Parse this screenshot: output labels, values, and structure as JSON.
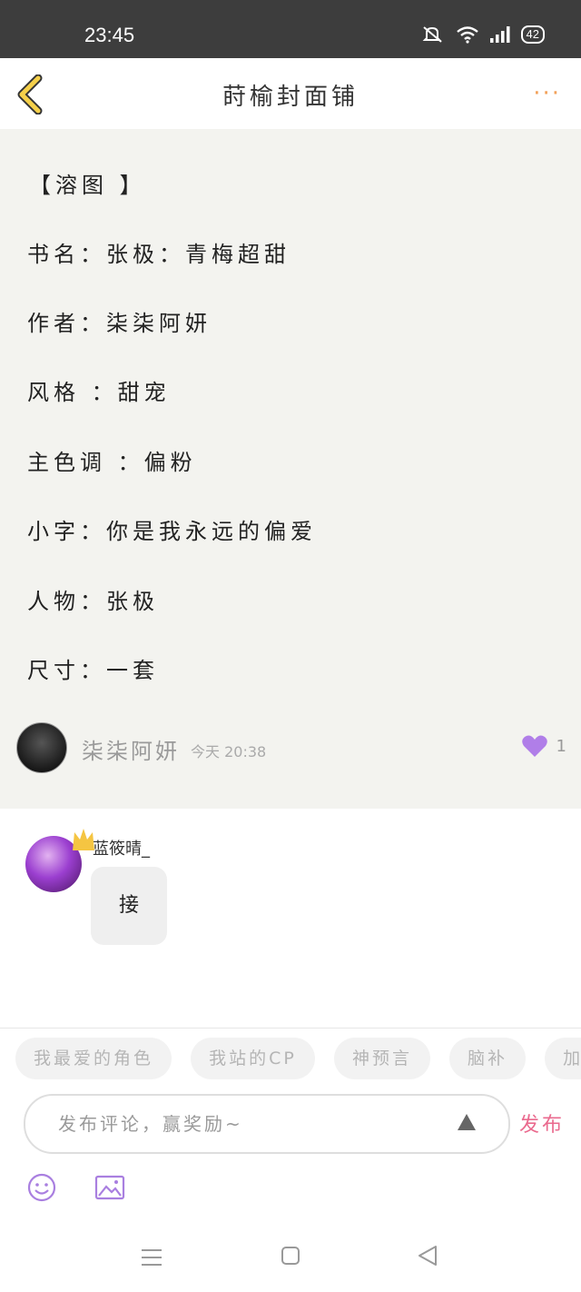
{
  "status_bar": {
    "time": "23:45",
    "battery": "42"
  },
  "header": {
    "title": "莳榆封面铺",
    "more_label": "···"
  },
  "post": {
    "lines": [
      "【溶图 】",
      "书名：张极：青梅超甜",
      "作者：柒柒阿妍",
      "风格 ：甜宠",
      "主色调 ：偏粉",
      "小字：你是我永远的偏爱",
      "人物：张极",
      "尺寸：一套"
    ],
    "author": "柒柒阿妍",
    "time": "今天 20:38",
    "likes": "1"
  },
  "comment": {
    "user": "蓝筱晴_",
    "text": "接"
  },
  "tags": [
    "我最爱的角色",
    "我站的CP",
    "神预言",
    "脑补",
    "加"
  ],
  "composer": {
    "placeholder": "发布评论，赢奖励~",
    "send_label": "发布"
  },
  "colors": {
    "accent_orange": "#f2a15a",
    "heart_purple": "#b07ee8",
    "send_pink": "#ea6a8e",
    "post_bg": "#f3f3ef"
  },
  "icons": [
    "mute-icon",
    "wifi-icon",
    "signal-icon",
    "battery-icon",
    "back-arrow-icon",
    "more-icon",
    "heart-icon",
    "crown-icon",
    "send-up-icon",
    "emoji-icon",
    "image-icon",
    "menu-icon",
    "home-icon",
    "back-icon"
  ]
}
